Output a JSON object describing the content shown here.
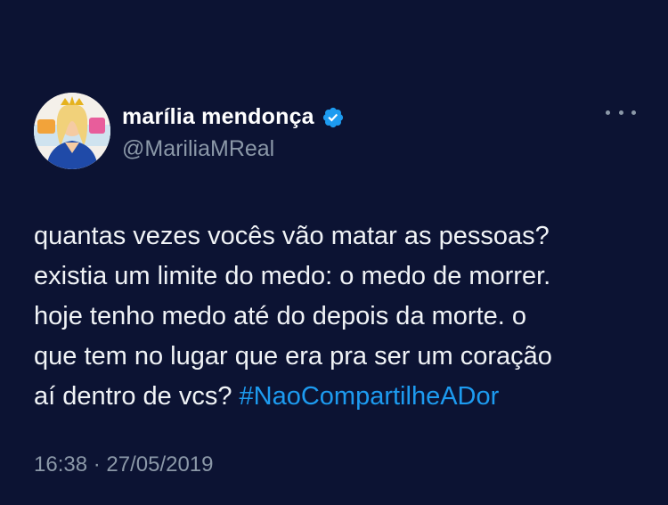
{
  "user": {
    "display_name": "marília mendonça",
    "handle": "@MariliaMReal",
    "verified": true,
    "avatar_icon": "profile-photo"
  },
  "tweet": {
    "lines": [
      "quantas vezes vocês vão matar as pessoas?",
      "existia um limite do medo: o medo de morrer.",
      "hoje tenho medo até do depois da morte. o",
      "que tem no lugar que era pra ser um coração",
      "aí dentro de vcs? "
    ],
    "hashtag": "#NaoCompartilheADor"
  },
  "timestamp": "16:38 · 27/05/2019",
  "colors": {
    "background": "#0c1333",
    "text": "#f0f3f6",
    "secondary": "#8b98a8",
    "accent": "#1d9bf0"
  },
  "icons": {
    "more": "more-horizontal-icon",
    "verified": "verified-badge-icon"
  }
}
